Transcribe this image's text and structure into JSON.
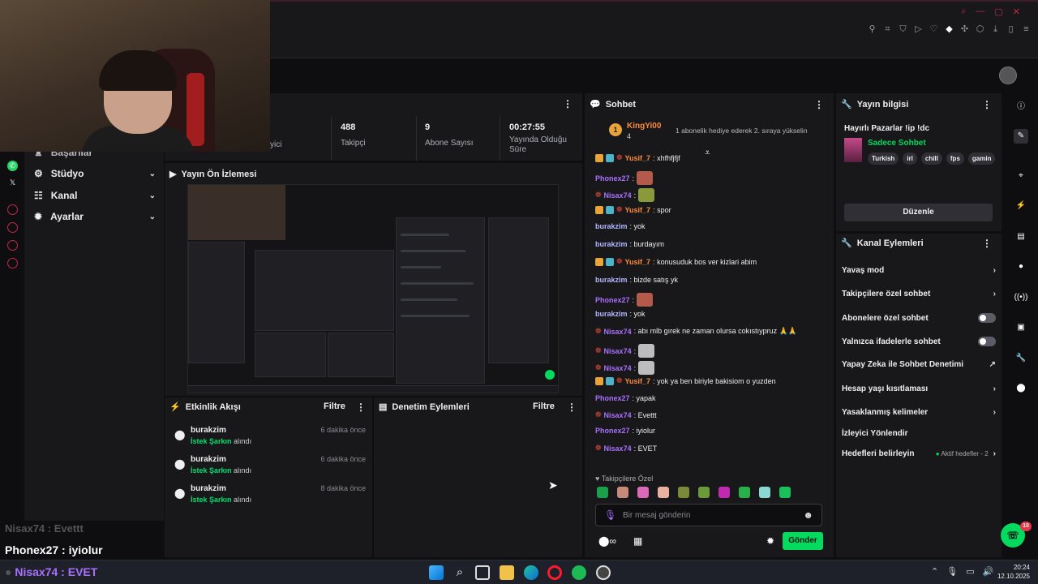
{
  "colors": {
    "accent": "#00db5f",
    "purple": "#a970ff",
    "orange": "#ff8a3c",
    "panel": "#18181b",
    "bg": "#0e0e10"
  },
  "nav": {
    "partial_item": "Başarılar",
    "items": [
      {
        "label": "Stüdyo",
        "icon": "studio-icon"
      },
      {
        "label": "Kanal",
        "icon": "channel-icon"
      },
      {
        "label": "Ayarlar",
        "icon": "gear-icon"
      }
    ]
  },
  "stats": {
    "partial_label": "yici",
    "items": [
      {
        "value": "488",
        "label": "Takipçi"
      },
      {
        "value": "9",
        "label": "Abone Sayısı"
      },
      {
        "value": "00:27:55",
        "label": "Yayında Olduğu Süre"
      }
    ]
  },
  "preview": {
    "title": "Yayın Ön İzlemesi"
  },
  "activity": {
    "title": "Etkinlik Akışı",
    "filter": "Filtre",
    "rows": [
      {
        "user": "burakzim",
        "event": "İstek Şarkın",
        "suffix": "alındı",
        "time": "6 dakika önce"
      },
      {
        "user": "burakzim",
        "event": "İstek Şarkın",
        "suffix": "alındı",
        "time": "6 dakika önce"
      },
      {
        "user": "burakzim",
        "event": "İstek Şarkın",
        "suffix": "alındı",
        "time": "8 dakika önce"
      }
    ]
  },
  "moderation": {
    "title": "Denetim Eylemleri",
    "filter": "Filtre"
  },
  "chat": {
    "title": "Sohbet",
    "pinned": {
      "user": "KingYi00",
      "count": "4",
      "message": "1 abonelik hediye ederek 2. sıraya yükselin",
      "rank": "1"
    },
    "messages": [
      {
        "user": "Yusif_7",
        "color": "orange",
        "text": ": xhfhfjfjf"
      },
      {
        "user": "Phonex27",
        "color": "purple",
        "text": ":"
      },
      {
        "user": "Nisax74",
        "color": "purple",
        "text": ":"
      },
      {
        "user": "Yusif_7",
        "color": "orange",
        "text": ": spor"
      },
      {
        "user": "burakzim",
        "color": "blue",
        "text": ": yok"
      },
      {
        "user": "burakzim",
        "color": "blue",
        "text": ": burdayım"
      },
      {
        "user": "Yusif_7",
        "color": "orange",
        "text": ": konusuduk bos ver kizlari abim"
      },
      {
        "user": "burakzim",
        "color": "blue",
        "text": ": bizde satış yk"
      },
      {
        "user": "Phonex27",
        "color": "purple",
        "text": ":"
      },
      {
        "user": "burakzim",
        "color": "blue",
        "text": ": yok"
      },
      {
        "user": "Nisax74",
        "color": "purple",
        "text": ": abı mlb gırek ne zaman olursa cokıstıypruz 🙏🙏"
      },
      {
        "user": "Nisax74",
        "color": "purple",
        "text": ":"
      },
      {
        "user": "Nisax74",
        "color": "purple",
        "text": ":"
      },
      {
        "user": "Yusif_7",
        "color": "orange",
        "text": ": yok ya ben biriyle bakisiom o yuzden"
      },
      {
        "user": "Phonex27",
        "color": "purple",
        "text": ": yapak"
      },
      {
        "user": "Nisax74",
        "color": "purple",
        "text": ": Evettt"
      },
      {
        "user": "Phonex27",
        "color": "purple",
        "text": ": iyiolur"
      },
      {
        "user": "Nisax74",
        "color": "purple",
        "text": ": EVET"
      }
    ],
    "followers_only": "Takipçilere Özel",
    "input_placeholder": "Bir mesaj gönderin",
    "send": "Gönder"
  },
  "info": {
    "title": "Yayın bilgisi",
    "stream_title": "Hayırlı Pazarlar !ip !dc",
    "category": "Sadece Sohbet",
    "tags": [
      "Turkish",
      "irl",
      "chill",
      "fps",
      "gamin"
    ],
    "edit": "Düzenle"
  },
  "actions": {
    "title": "Kanal Eylemleri",
    "items": [
      {
        "label": "Yavaş mod",
        "type": "chevron"
      },
      {
        "label": "Takipçilere özel sohbet",
        "type": "chevron"
      },
      {
        "label": "Abonelere özel sohbet",
        "type": "toggle"
      },
      {
        "label": "Yalnızca ifadelerle sohbet",
        "type": "toggle"
      },
      {
        "label": "Yapay Zeka ile Sohbet Denetimi",
        "type": "external"
      },
      {
        "label": "Hesap yaşı kısıtlaması",
        "type": "chevron"
      },
      {
        "label": "Yasaklanmış kelimeler",
        "type": "chevron"
      },
      {
        "label": "İzleyici Yönlendir",
        "type": "none"
      },
      {
        "label": "Hedefleri belirleyin",
        "type": "goal"
      }
    ],
    "goal_status": "Aktif hedefler - 2"
  },
  "overlay": {
    "line1": "Nisax74 : Evettt",
    "line2": "Phonex27 : iyiolur",
    "line3": "Nisax74 : EVET"
  },
  "notification_count": "10",
  "taskbar": {
    "time": "20:24",
    "date": "12.10.2025"
  }
}
